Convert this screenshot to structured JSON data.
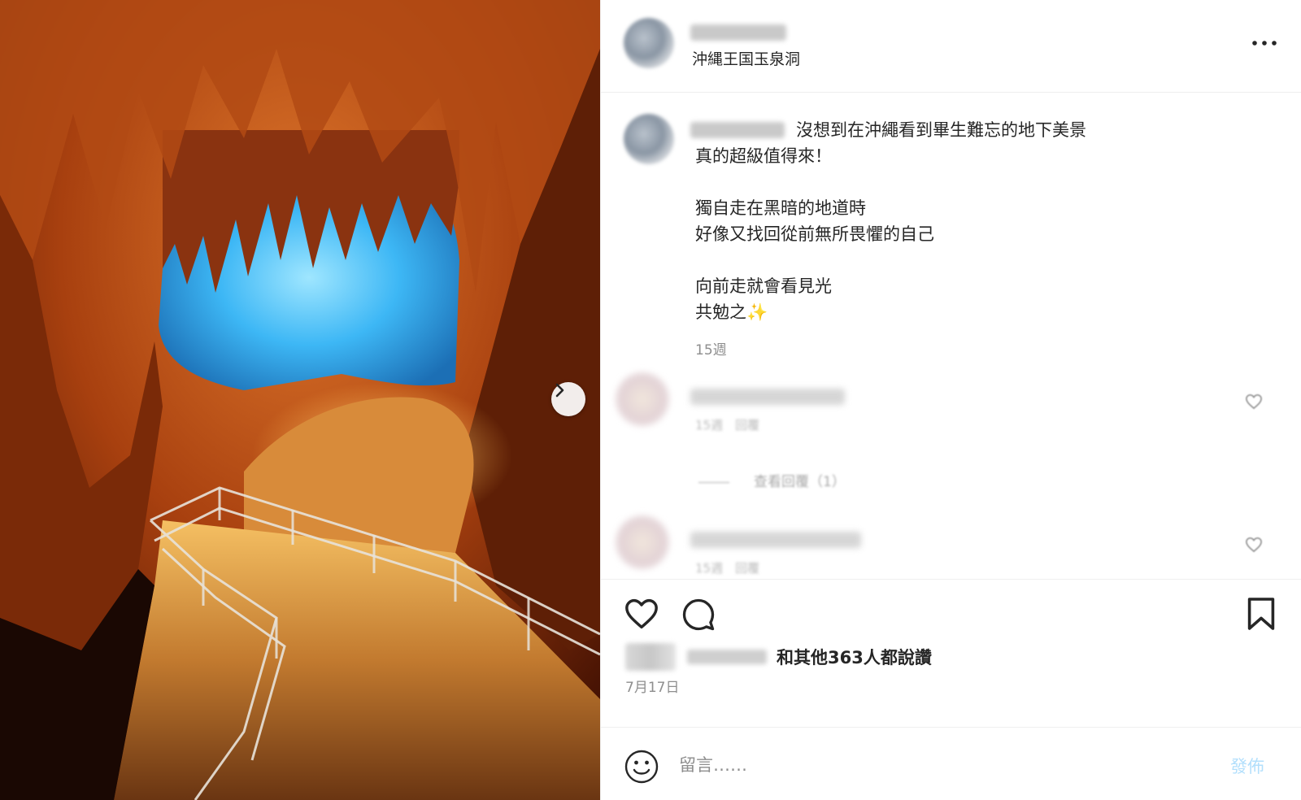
{
  "post": {
    "location": "沖縄王国玉泉洞",
    "caption": "沒想到在沖繩看到畢生難忘的地下美景\n真的超級值得來！\n\n獨自走在黑暗的地道時\n好像又找回從前無所畏懼的自己\n\n向前走就會看見光\n共勉之✨",
    "caption_time": "15週"
  },
  "comments": [
    {
      "meta": "15週　回覆",
      "view_replies": "查看回覆（1）"
    },
    {
      "meta": "15週　回覆"
    }
  ],
  "likes": {
    "text": "和其他363人都說讚"
  },
  "date": "7月17日",
  "comment_box": {
    "placeholder": "留言……",
    "post_label": "發佈"
  },
  "icons": {
    "next": "chevron-right-icon",
    "more": "more-horizontal-icon",
    "like": "heart-icon",
    "comment": "comment-bubble-icon",
    "save": "bookmark-icon",
    "emoji": "emoji-smile-icon"
  },
  "colors": {
    "post_button": "#b2dffc",
    "muted_text": "#8e8e8e",
    "cave_blue": "#39b8ff",
    "cave_orange": "#c9521a"
  }
}
